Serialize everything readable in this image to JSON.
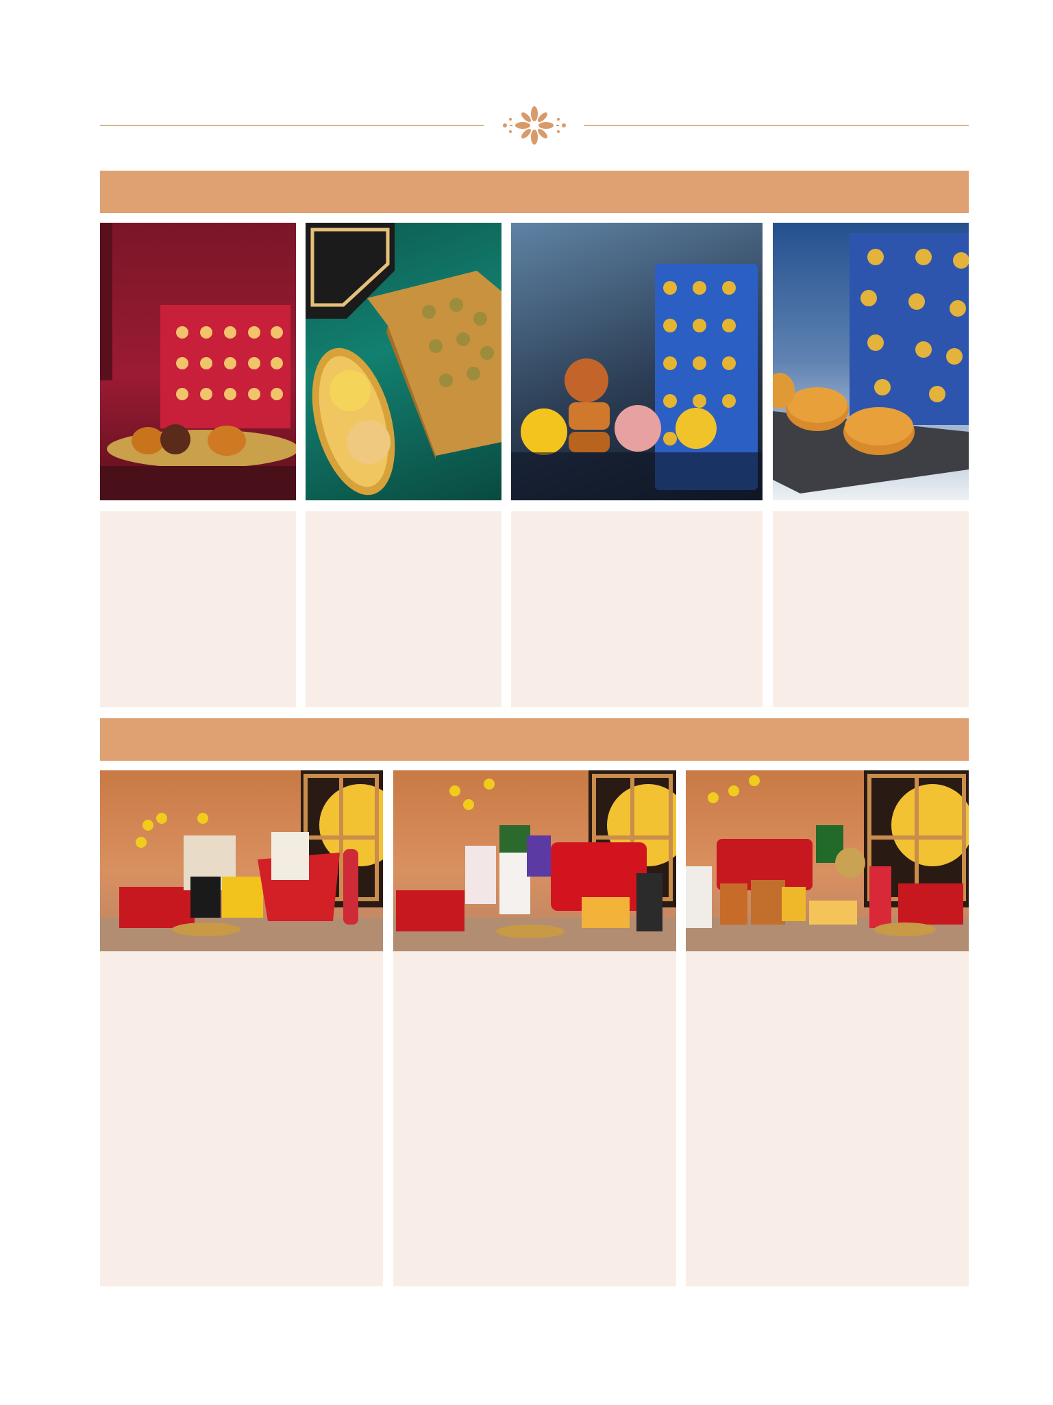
{
  "theme": {
    "accent": "#dfa072",
    "card_bg": "#f9eee7",
    "divider": "#dcb48c"
  },
  "header": {
    "ornament_icon": "floral-ornament-icon"
  },
  "section_1": {
    "title": "",
    "items": [
      {
        "image": "mooncake-red-box-photo",
        "caption": ""
      },
      {
        "image": "mooncake-gold-box-photo",
        "caption": ""
      },
      {
        "image": "mooncake-blue-case-photo",
        "caption": ""
      },
      {
        "image": "mooncake-blue-box-slate-photo",
        "caption": ""
      }
    ]
  },
  "section_2": {
    "title": "",
    "items": [
      {
        "image": "hamper-red-bucket-photo",
        "caption": ""
      },
      {
        "image": "hamper-red-trunk-photo",
        "caption": ""
      },
      {
        "image": "hamper-red-chest-photo",
        "caption": ""
      }
    ]
  }
}
